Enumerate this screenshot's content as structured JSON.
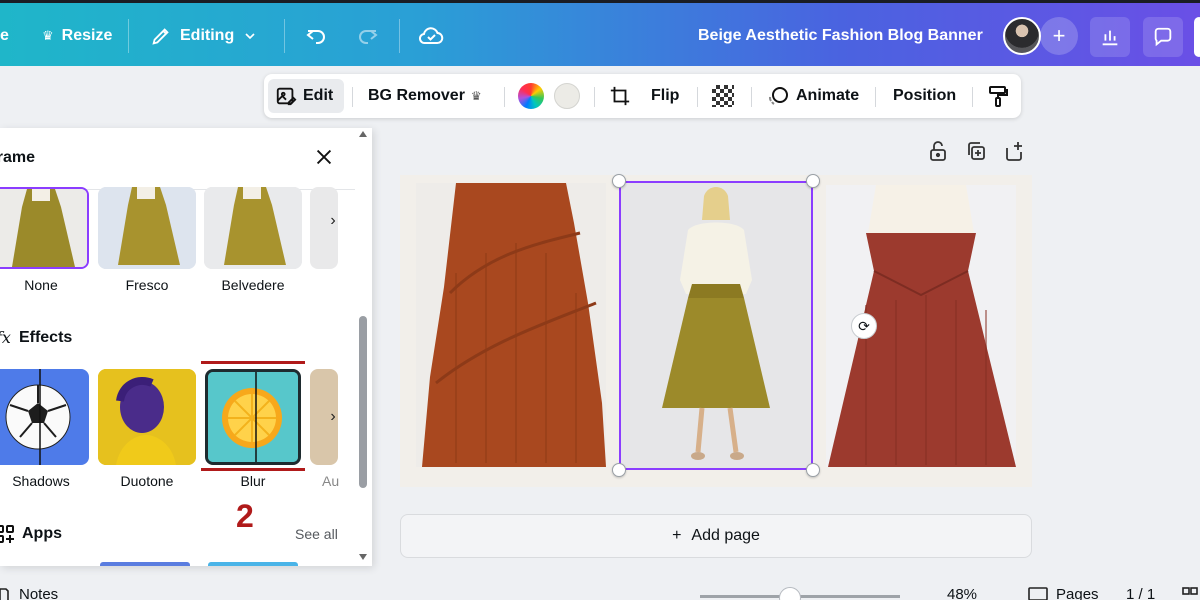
{
  "header": {
    "partial_left_label": "e",
    "resize_label": "Resize",
    "editing_label": "Editing",
    "design_title": "Beige Aesthetic Fashion Blog Banner"
  },
  "toolbar": {
    "edit_label": "Edit",
    "bg_remover_label": "BG Remover",
    "flip_label": "Flip",
    "animate_label": "Animate",
    "position_label": "Position"
  },
  "panel": {
    "title": "Frame",
    "frame_options": [
      {
        "label": "None"
      },
      {
        "label": "Fresco"
      },
      {
        "label": "Belvedere"
      }
    ],
    "effects_title": "Effects",
    "effects_icon": "fx",
    "effects": [
      {
        "label": "Shadows"
      },
      {
        "label": "Duotone"
      },
      {
        "label": "Blur"
      },
      {
        "label": "Au"
      }
    ],
    "apps_title": "Apps",
    "see_all": "See all",
    "annotation_number": "2"
  },
  "canvas": {
    "add_page_label": "Add page",
    "add_page_icon": "+"
  },
  "bottom_bar": {
    "notes_label": "Notes",
    "zoom_value": "48%",
    "pages_label": "Pages",
    "page_count": "1 / 1"
  },
  "colors": {
    "selection": "#8b3dff",
    "annotation_red": "#b01a1a",
    "header_start": "#1fb6c9",
    "header_end": "#6a4fe6"
  }
}
